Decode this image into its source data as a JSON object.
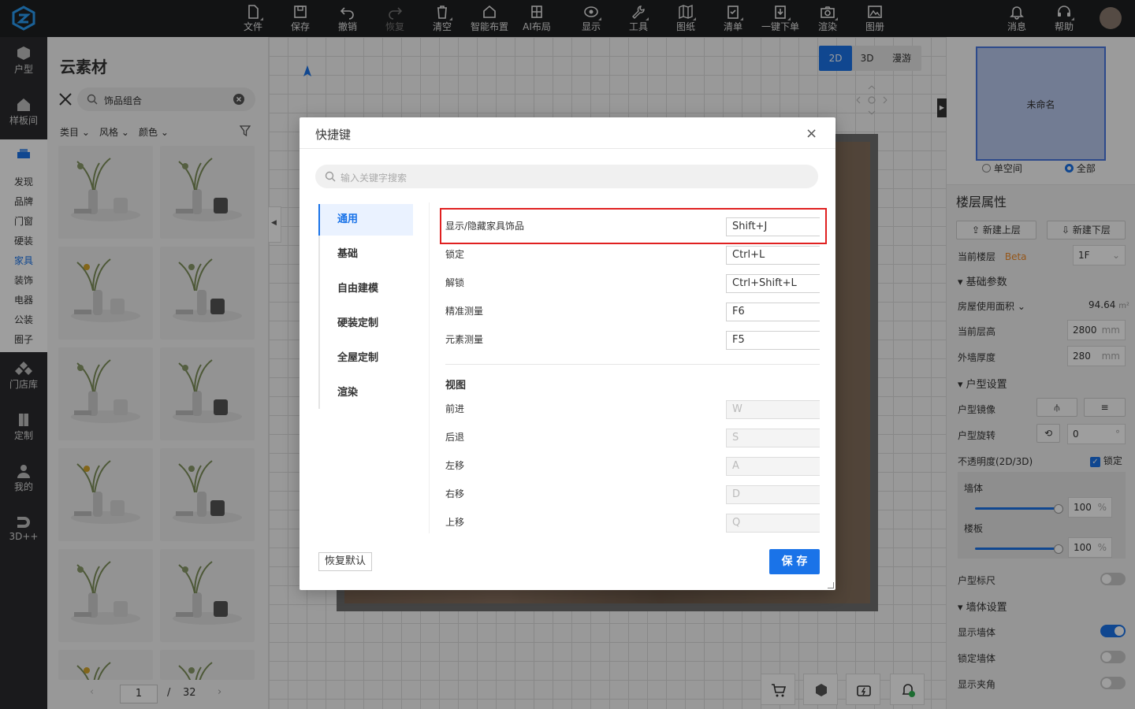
{
  "toolbar": {
    "items": [
      {
        "label": "文件",
        "icon": "file-icon"
      },
      {
        "label": "保存",
        "icon": "save-icon"
      },
      {
        "label": "撤销",
        "icon": "undo-icon"
      },
      {
        "label": "恢复",
        "icon": "redo-icon"
      },
      {
        "label": "清空",
        "icon": "trash-icon"
      },
      {
        "label": "智能布置",
        "icon": "home-icon"
      },
      {
        "label": "AI布局",
        "icon": "building-icon"
      },
      {
        "label": "显示",
        "icon": "eye-icon"
      },
      {
        "label": "工具",
        "icon": "wrench-icon"
      },
      {
        "label": "图纸",
        "icon": "map-icon"
      },
      {
        "label": "清单",
        "icon": "checklist-icon"
      },
      {
        "label": "一键下单",
        "icon": "order-icon"
      },
      {
        "label": "渲染",
        "icon": "camera-icon"
      },
      {
        "label": "图册",
        "icon": "image-icon"
      }
    ],
    "right": [
      {
        "label": "消息",
        "icon": "bell-icon"
      },
      {
        "label": "帮助",
        "icon": "headset-icon"
      }
    ]
  },
  "leftnav": {
    "top": [
      {
        "label": "户型"
      },
      {
        "label": "样板间"
      }
    ],
    "sub": [
      "发现",
      "品牌",
      "门窗",
      "硬装",
      "家具",
      "装饰",
      "电器",
      "公装",
      "圈子"
    ],
    "active_sub": "家具",
    "bottom": [
      {
        "label": "门店库"
      },
      {
        "label": "定制"
      },
      {
        "label": "我的"
      },
      {
        "label": "3D++"
      }
    ]
  },
  "panel": {
    "title": "云素材",
    "search_value": "饰品组合",
    "filters": [
      "类目",
      "风格",
      "颜色"
    ],
    "page_current": "1",
    "page_sep": "/",
    "page_total": "32"
  },
  "canvas": {
    "views": [
      "2D",
      "3D",
      "漫游"
    ],
    "active_view": "2D"
  },
  "right": {
    "mini_room_name": "未命名",
    "radio_single": "单空间",
    "radio_all": "全部",
    "floor_title": "楼层属性",
    "btn_new_up": "新建上层",
    "btn_new_down": "新建下层",
    "current_floor_label": "当前楼层",
    "beta": "Beta",
    "current_floor_value": "1F",
    "sec_basic": "基础参数",
    "area_label": "房屋使用面积",
    "area_value": "94.64",
    "area_unit": "m²",
    "height_label": "当前层高",
    "height_value": "2800",
    "height_unit": "mm",
    "wall_label": "外墙厚度",
    "wall_value": "280",
    "wall_unit": "mm",
    "sec_layout": "户型设置",
    "mirror_label": "户型镜像",
    "rotate_label": "户型旋转",
    "rotate_value": "0",
    "rotate_unit": "°",
    "opacity_label": "不透明度(2D/3D)",
    "lock_label": "锁定",
    "wall_opacity_label": "墙体",
    "wall_opacity_value": "100",
    "floor_opacity_label": "楼板",
    "floor_opacity_value": "100",
    "pct": "%",
    "ruler_label": "户型标尺",
    "sec_wall": "墙体设置",
    "show_wall_label": "显示墙体",
    "lock_wall_label": "锁定墙体",
    "show_angle_label": "显示夹角"
  },
  "dialog": {
    "title": "快捷键",
    "close": "×",
    "search_placeholder": "输入关键字搜索",
    "categories": [
      "通用",
      "基础",
      "自由建模",
      "硬装定制",
      "全屋定制",
      "渲染"
    ],
    "active_category": "通用",
    "general": [
      {
        "label": "显示/隐藏家具饰品",
        "key": "Shift+J"
      },
      {
        "label": "锁定",
        "key": "Ctrl+L"
      },
      {
        "label": "解锁",
        "key": "Ctrl+Shift+L"
      },
      {
        "label": "精准测量",
        "key": "F6"
      },
      {
        "label": "元素测量",
        "key": "F5"
      }
    ],
    "view_heading": "视图",
    "view": [
      {
        "label": "前进",
        "key": "W"
      },
      {
        "label": "后退",
        "key": "S"
      },
      {
        "label": "左移",
        "key": "A"
      },
      {
        "label": "右移",
        "key": "D"
      },
      {
        "label": "上移",
        "key": "Q"
      }
    ],
    "reset_label": "恢复默认",
    "save_label": "保 存"
  },
  "colors": {
    "accent": "#1a73e8",
    "highlight": "#e02020",
    "topbar": "#1e1f21"
  }
}
